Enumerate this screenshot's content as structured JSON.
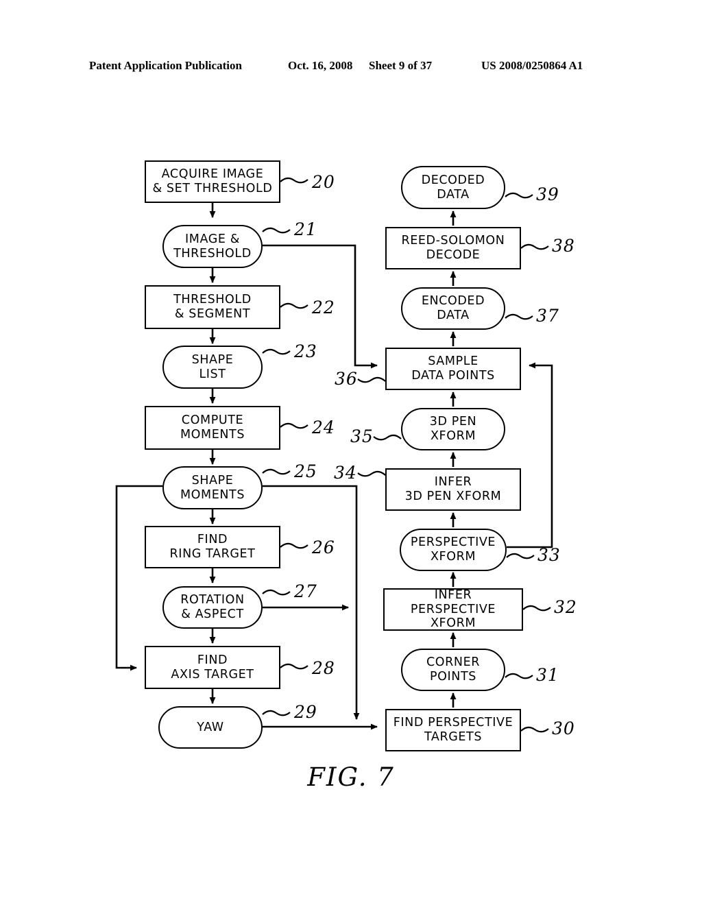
{
  "header": {
    "publication": "Patent Application Publication",
    "date": "Oct. 16, 2008",
    "sheet": "Sheet 9 of 37",
    "patent_number": "US 2008/0250864 A1"
  },
  "figure": {
    "caption": "FIG. 7",
    "nodes": [
      {
        "ref": "20",
        "label": "ACQUIRE IMAGE\n& SET THRESHOLD",
        "shape": "rect"
      },
      {
        "ref": "21",
        "label": "IMAGE &\nTHRESHOLD",
        "shape": "stadium"
      },
      {
        "ref": "22",
        "label": "THRESHOLD\n& SEGMENT",
        "shape": "rect"
      },
      {
        "ref": "23",
        "label": "SHAPE\nLIST",
        "shape": "stadium"
      },
      {
        "ref": "24",
        "label": "COMPUTE\nMOMENTS",
        "shape": "rect"
      },
      {
        "ref": "25",
        "label": "SHAPE\nMOMENTS",
        "shape": "stadium"
      },
      {
        "ref": "26",
        "label": "FIND\nRING TARGET",
        "shape": "rect"
      },
      {
        "ref": "27",
        "label": "ROTATION\n& ASPECT",
        "shape": "stadium"
      },
      {
        "ref": "28",
        "label": "FIND\nAXIS TARGET",
        "shape": "rect"
      },
      {
        "ref": "29",
        "label": "YAW",
        "shape": "stadium"
      },
      {
        "ref": "30",
        "label": "FIND PERSPECTIVE\nTARGETS",
        "shape": "rect"
      },
      {
        "ref": "31",
        "label": "CORNER\nPOINTS",
        "shape": "stadium"
      },
      {
        "ref": "32",
        "label": "INFER\nPERSPECTIVE XFORM",
        "shape": "rect"
      },
      {
        "ref": "33",
        "label": "PERSPECTIVE\nXFORM",
        "shape": "stadium"
      },
      {
        "ref": "34",
        "label": "INFER\n3D PEN XFORM",
        "shape": "rect"
      },
      {
        "ref": "35",
        "label": "3D PEN\nXFORM",
        "shape": "stadium"
      },
      {
        "ref": "36",
        "label": "SAMPLE\nDATA POINTS",
        "shape": "rect"
      },
      {
        "ref": "37",
        "label": "ENCODED\nDATA",
        "shape": "stadium"
      },
      {
        "ref": "38",
        "label": "REED-SOLOMON\nDECODE",
        "shape": "rect"
      },
      {
        "ref": "39",
        "label": "DECODED\nDATA",
        "shape": "stadium"
      }
    ]
  },
  "colors": {
    "line": "#000000",
    "background": "#ffffff"
  }
}
